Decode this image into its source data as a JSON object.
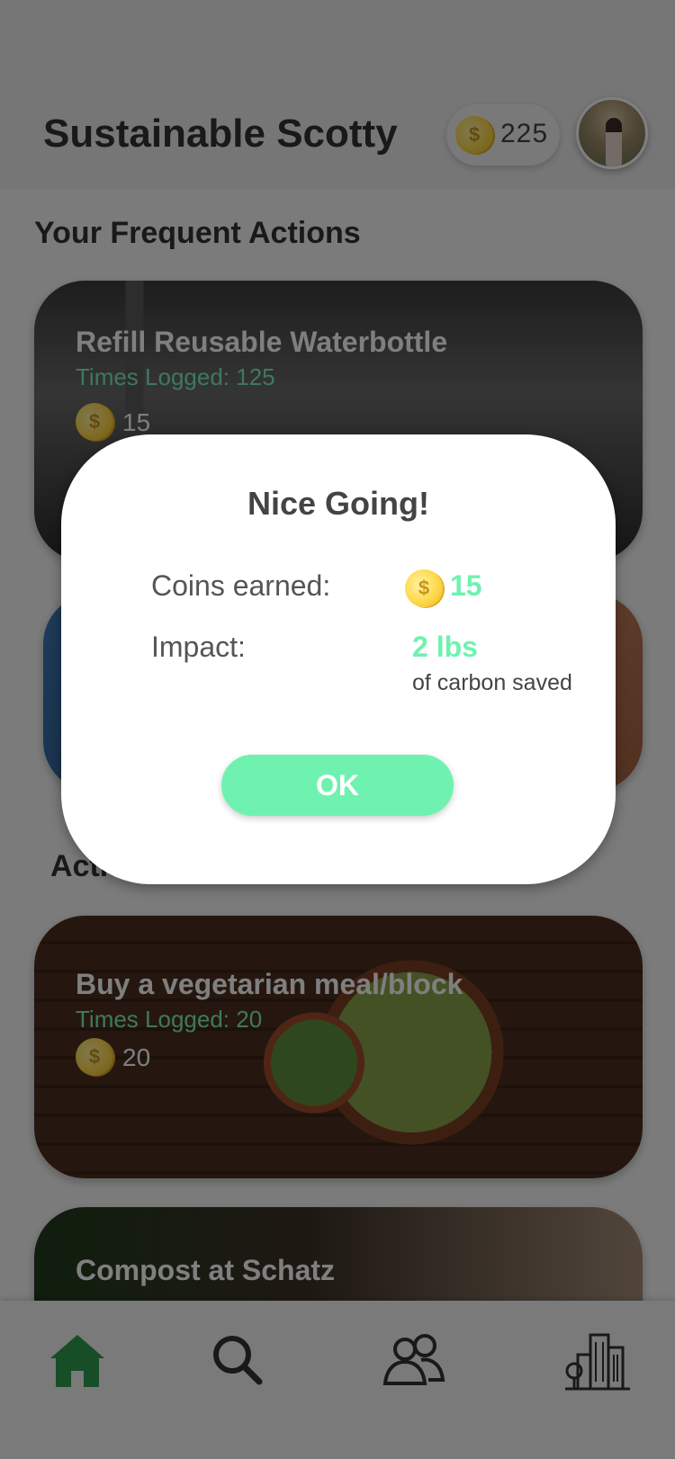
{
  "app": {
    "title": "Sustainable Scotty",
    "coin_balance": "225",
    "coin_symbol": "$"
  },
  "sections": {
    "frequent": "Your Frequent Actions",
    "actions_partial": "Acti"
  },
  "cards": [
    {
      "title": "Refill Reusable Waterbottle",
      "logged": "Times Logged: 125",
      "coins": "15"
    },
    {
      "title": "Buy a vegetarian meal/block",
      "logged": "Times Logged: 20",
      "coins": "20"
    },
    {
      "title": "Compost at Schatz"
    }
  ],
  "modal": {
    "title": "Nice Going!",
    "coins_label": "Coins earned:",
    "coins_value": "15",
    "impact_label": "Impact:",
    "impact_value": "2 lbs",
    "impact_sub": "of carbon saved",
    "ok_label": "OK"
  },
  "nav": {
    "items": [
      "home-icon",
      "search-icon",
      "people-icon",
      "city-icon"
    ],
    "active_color": "#2e9a4e",
    "inactive_color": "#333333"
  },
  "colors": {
    "accent_green": "#6ff2b0",
    "coin_gold": "#ffd84a"
  }
}
